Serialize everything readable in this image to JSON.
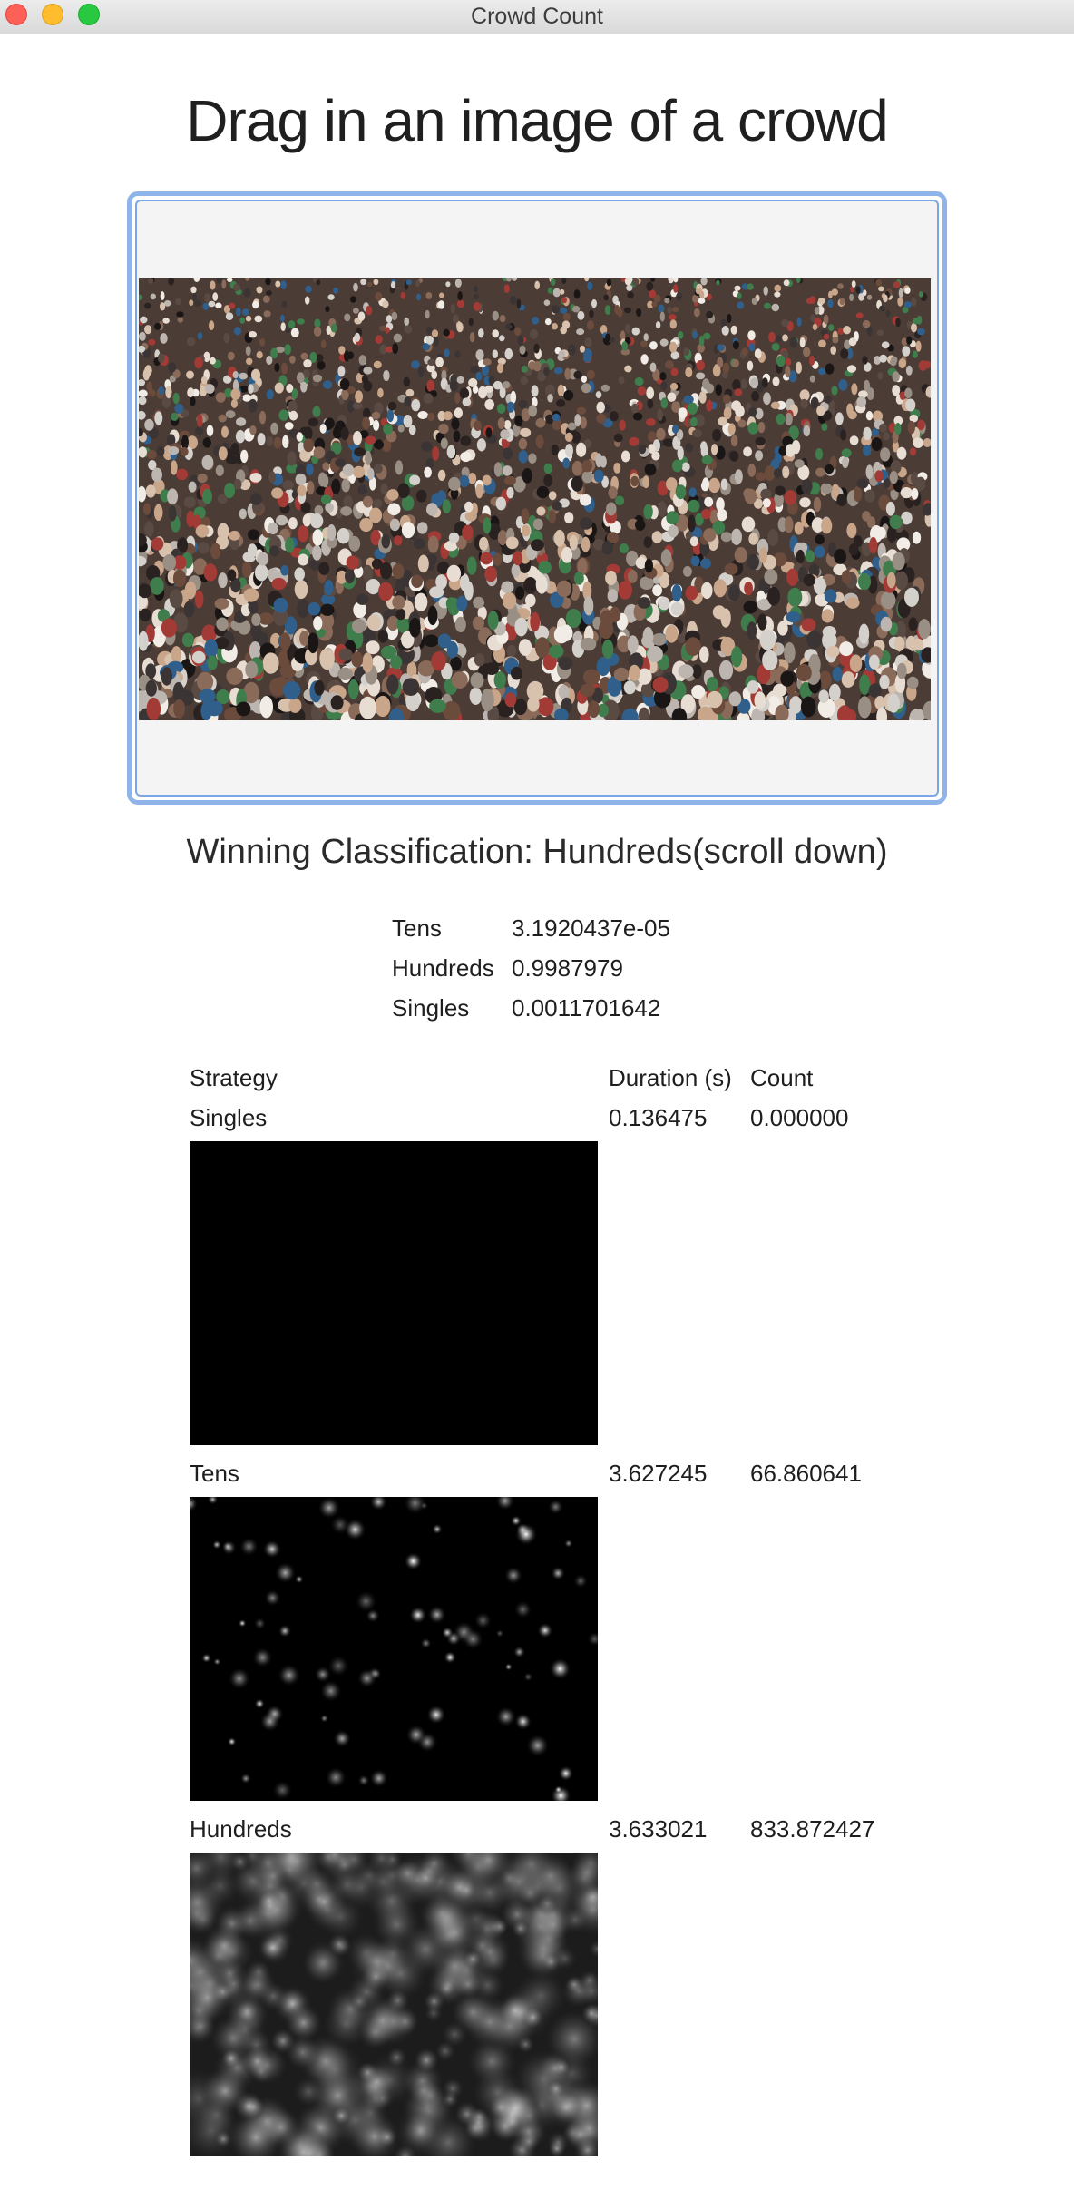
{
  "window": {
    "title": "Crowd Count"
  },
  "headline": "Drag in an image of a crowd",
  "dropzone": {
    "image_alt": "crowd photo",
    "accent_color": "#8fb4ea"
  },
  "classification": {
    "winning_text": "Winning Classification: Hundreds(scroll down)",
    "probabilities": [
      {
        "name": "Tens",
        "value": "3.1920437e-05"
      },
      {
        "name": "Hundreds",
        "value": "0.9987979"
      },
      {
        "name": "Singles",
        "value": "0.0011701642"
      }
    ]
  },
  "table": {
    "headers": {
      "strategy": "Strategy",
      "duration": "Duration (s)",
      "count": "Count"
    },
    "rows": [
      {
        "strategy": "Singles",
        "duration": "0.136475",
        "count": "0.000000",
        "density_map": "black"
      },
      {
        "strategy": "Tens",
        "duration": "3.627245",
        "count": "66.860641",
        "density_map": "sparse-dots"
      },
      {
        "strategy": "Hundreds",
        "duration": "3.633021",
        "count": "833.872427",
        "density_map": "blurry-cloud"
      }
    ]
  }
}
